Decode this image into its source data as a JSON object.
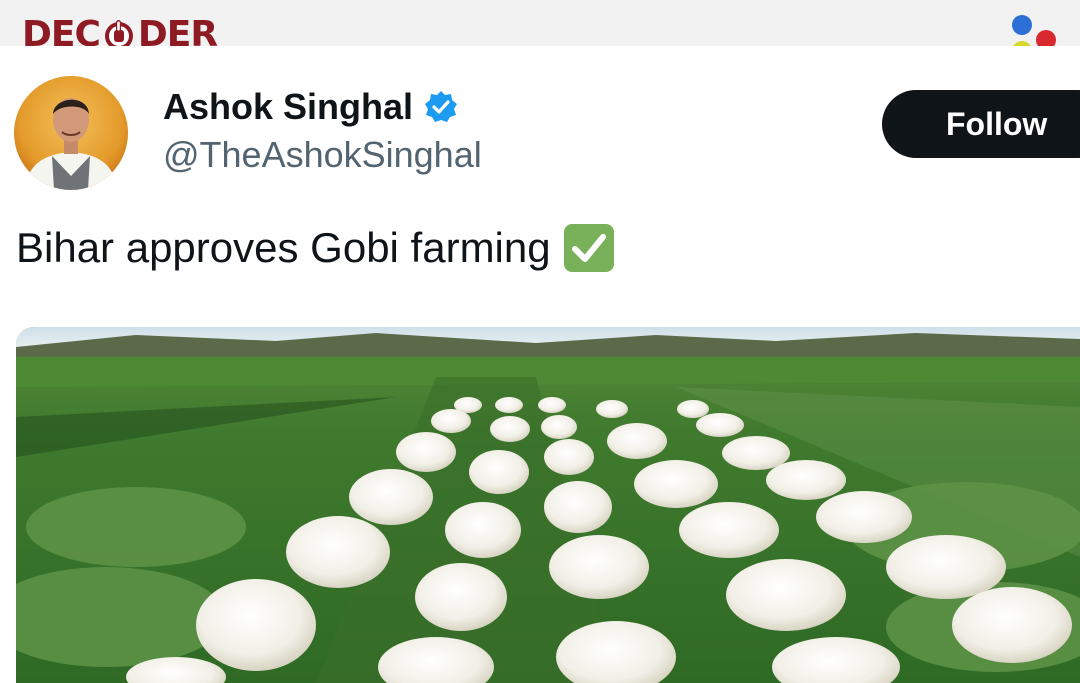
{
  "header": {
    "brand_left": "DEC",
    "brand_right": "DER",
    "brand_mid_icon": "hand-o-icon",
    "brand_color": "#8e1a24",
    "dots_icon": "four-color-dots-icon"
  },
  "tweet": {
    "author_name": "Ashok Singhal",
    "handle": "@TheAshokSinghal",
    "verified_icon": "verified-badge-icon",
    "follow_label": "Follow",
    "text": "Bihar approves Gobi farming",
    "emoji": "check-mark-button-emoji",
    "media_subject": "cauliflower-field-photo"
  },
  "colors": {
    "text": "#0f1419",
    "secondary": "#536471",
    "verified": "#1d9bf0",
    "follow_bg": "#0f1419",
    "emoji_green": "#78b159"
  }
}
